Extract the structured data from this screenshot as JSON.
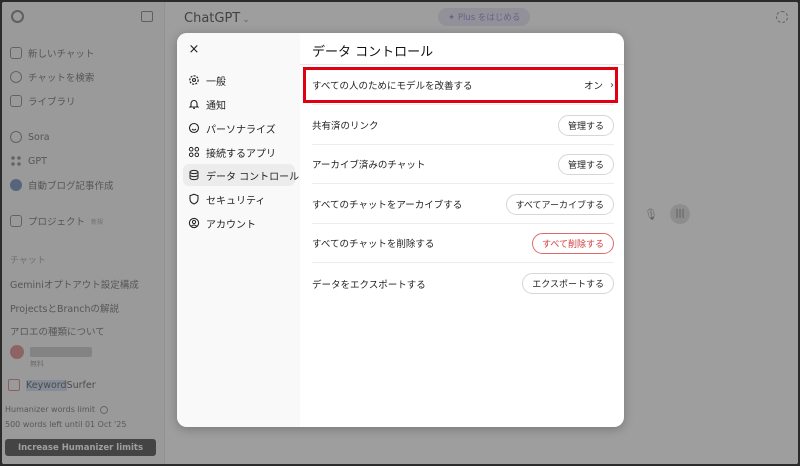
{
  "sidebar": {
    "items": [
      {
        "label": "新しいチャット",
        "icon": "new-chat-icon"
      },
      {
        "label": "チャットを検索",
        "icon": "search-icon"
      },
      {
        "label": "ライブラリ",
        "icon": "library-icon"
      },
      {
        "label": "Sora",
        "icon": "sora-icon"
      },
      {
        "label": "GPT",
        "icon": "gpts-icon"
      },
      {
        "label": "自動ブログ記事作成",
        "icon": "gpt-avatar-icon"
      },
      {
        "label": "プロジェクト",
        "badge": "新規",
        "icon": "folder-icon"
      }
    ],
    "chats_heading": "チャット",
    "chats": [
      "Geminiオプトアウト設定構成",
      "ProjectsとBranchの解説",
      "アロエの種類について"
    ],
    "user_sub": "無料",
    "keyword_prefix": "Keyword",
    "keyword_suffix": " Surfer",
    "limit_title": "Humanizer words limit",
    "limit_detail": "500 words left until 01 Oct '25",
    "increase_button": "Increase Humanizer limits"
  },
  "main": {
    "title": "ChatGPT",
    "plus_label": "✦ Plus をはじめる"
  },
  "modal": {
    "close_icon": "×",
    "nav": [
      {
        "label": "一般",
        "icon": "gear-icon"
      },
      {
        "label": "通知",
        "icon": "bell-icon"
      },
      {
        "label": "パーソナライズ",
        "icon": "personalize-icon"
      },
      {
        "label": "接続するアプリ",
        "icon": "apps-icon"
      },
      {
        "label": "データ コントロール",
        "icon": "database-icon",
        "active": true
      },
      {
        "label": "セキュリティ",
        "icon": "shield-icon"
      },
      {
        "label": "アカウント",
        "icon": "account-icon"
      }
    ],
    "title": "データ コントロール",
    "rows": [
      {
        "label": "すべての人のためにモデルを改善する",
        "value": "オン"
      },
      {
        "label": "共有済のリンク",
        "button": "管理する"
      },
      {
        "label": "アーカイブ済みのチャット",
        "button": "管理する"
      },
      {
        "label": "すべてのチャットをアーカイブする",
        "button": "すべてアーカイブする"
      },
      {
        "label": "すべてのチャットを削除する",
        "button": "すべて削除する",
        "danger": true
      },
      {
        "label": "データをエクスポートする",
        "button": "エクスポートする"
      }
    ]
  },
  "colors": {
    "highlight_border": "#e00012",
    "danger": "#d13b3b",
    "active_nav": "#ececec"
  }
}
